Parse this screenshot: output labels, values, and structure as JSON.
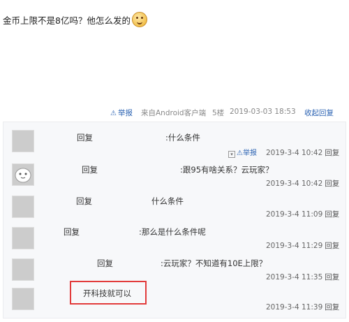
{
  "post": {
    "text": "金币上限不是8亿吗？他怎么发的",
    "emoji_icon": "smiley-emoji-icon"
  },
  "meta": {
    "report_label": "举报",
    "source": "来自Android客户端",
    "floor": "5楼",
    "time": "2019-03-03 18:53",
    "collapse_label": "收起回复"
  },
  "replies": [
    {
      "label": "回复",
      "content": ":什么条件",
      "time": "2019-3-4 10:42",
      "reply_btn": "回复",
      "tools": "举报"
    },
    {
      "label": "回复",
      "content": ":跟95有啥关系？云玩家？",
      "time": "2019-3-4 10:42",
      "reply_btn": "回复"
    },
    {
      "label": "回复",
      "content": "什么条件",
      "time": "2019-3-4 11:09",
      "reply_btn": "回复"
    },
    {
      "label": "回复",
      "content": ":那么是什么条件呢",
      "time": "2019-3-4 11:29",
      "reply_btn": "回复"
    },
    {
      "label": "回复",
      "content": ":云玩家？不知道有10E上限？",
      "time": "2019-3-4 11:35",
      "reply_btn": "回复"
    },
    {
      "label": "",
      "content": "开科技就可以",
      "time": "2019-3-4 11:39",
      "reply_btn": "回复"
    }
  ],
  "colors": {
    "link": "#2d64b3",
    "highlight": "#e23b3b"
  }
}
